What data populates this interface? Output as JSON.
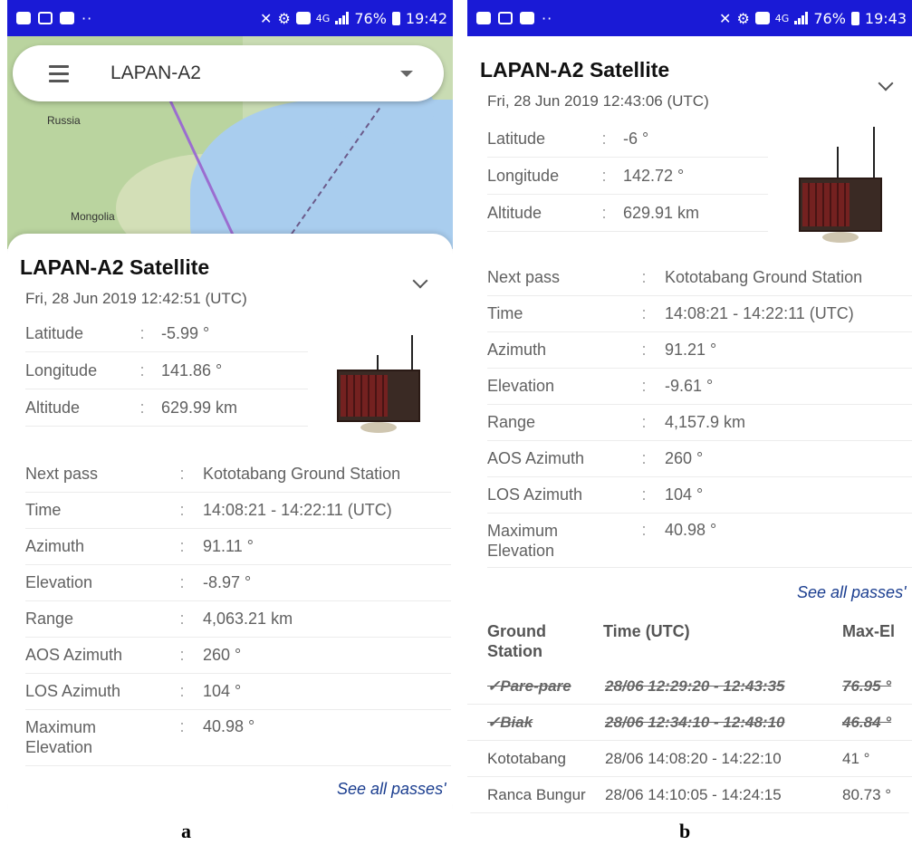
{
  "status_bar": {
    "battery": "76%",
    "network": "4G",
    "time_a": "19:42",
    "time_b": "19:43"
  },
  "panel_a": {
    "selector_title": "LAPAN-A2",
    "map_labels": [
      "Russia",
      "Mongolia"
    ],
    "title": "LAPAN-A2 Satellite",
    "datetime": "Fri, 28 Jun 2019 12:42:51 (UTC)",
    "position": [
      {
        "label": "Latitude",
        "value": "-5.99 °"
      },
      {
        "label": "Longitude",
        "value": "141.86 °"
      },
      {
        "label": "Altitude",
        "value": "629.99 km"
      }
    ],
    "next_pass": [
      {
        "label": "Next pass",
        "value": "Kototabang Ground Station"
      },
      {
        "label": "Time",
        "value": "14:08:21 - 14:22:11 (UTC)"
      },
      {
        "label": "Azimuth",
        "value": "91.11 °"
      },
      {
        "label": "Elevation",
        "value": "-8.97 °"
      },
      {
        "label": "Range",
        "value": "4,063.21 km"
      },
      {
        "label": "AOS Azimuth",
        "value": "260 °"
      },
      {
        "label": "LOS Azimuth",
        "value": "104 °"
      },
      {
        "label": "Maximum Elevation",
        "value": "40.98 °"
      }
    ],
    "see_all": "See all passes'"
  },
  "panel_b": {
    "title": "LAPAN-A2 Satellite",
    "datetime": "Fri, 28 Jun 2019 12:43:06 (UTC)",
    "position": [
      {
        "label": "Latitude",
        "value": "-6 °"
      },
      {
        "label": "Longitude",
        "value": "142.72 °"
      },
      {
        "label": "Altitude",
        "value": "629.91 km"
      }
    ],
    "next_pass": [
      {
        "label": "Next pass",
        "value": "Kototabang Ground Station"
      },
      {
        "label": "Time",
        "value": "14:08:21 - 14:22:11 (UTC)"
      },
      {
        "label": "Azimuth",
        "value": "91.21 °"
      },
      {
        "label": "Elevation",
        "value": "-9.61 °"
      },
      {
        "label": "Range",
        "value": "4,157.9 km"
      },
      {
        "label": "AOS Azimuth",
        "value": "260 °"
      },
      {
        "label": "LOS Azimuth",
        "value": "104 °"
      },
      {
        "label": "Maximum Elevation",
        "value": "40.98 °"
      }
    ],
    "see_all": "See all passes'",
    "table": {
      "headers": [
        "Ground Station",
        "Time (UTC)",
        "Max-El"
      ],
      "rows": [
        {
          "station": "✓Pare-pare",
          "time": "28/06 12:29:20 - 12:43:35",
          "max_el": "76.95 °",
          "passed": true
        },
        {
          "station": "✓Biak",
          "time": "28/06 12:34:10 - 12:48:10",
          "max_el": "46.84 °",
          "passed": true
        },
        {
          "station": "Kototabang",
          "time": "28/06 14:08:20 - 14:22:10",
          "max_el": "41 °",
          "passed": false
        },
        {
          "station": "Ranca Bungur",
          "time": "28/06 14:10:05 - 14:24:15",
          "max_el": "80.73 °",
          "passed": false
        }
      ]
    }
  },
  "figure_labels": {
    "a": "a",
    "b": "b"
  },
  "colors": {
    "status_bar": "#1a1ad6",
    "link": "#1a3d8f"
  }
}
